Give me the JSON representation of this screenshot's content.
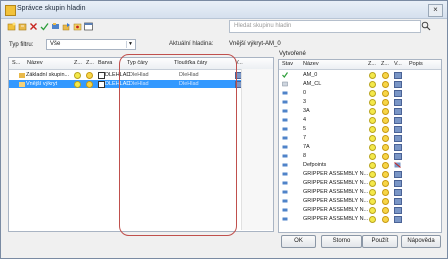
{
  "window": {
    "title": "Správce skupin hladin",
    "close_glyph": "×"
  },
  "search": {
    "placeholder": "Hledat skupinu hladin"
  },
  "filter": {
    "label": "Typ filtru:",
    "value": "Vše"
  },
  "active_layer": {
    "label": "Aktuální hladina:",
    "value": "Vnější výkryt-AM_0"
  },
  "left_panel": {
    "headers": [
      "S...",
      "Název",
      "Z...",
      "Z...",
      "Barva",
      "Typ čáry",
      "Tloušťka čáry",
      "V..."
    ],
    "rows": [
      {
        "name": "Základní skupin...",
        "color": "DLEHLAD",
        "linetype": "DleHlad",
        "lineweight": "DleHlad",
        "selected": false
      },
      {
        "name": "Vnější výkryt",
        "color": "DLEHLAD",
        "linetype": "DleHlad",
        "lineweight": "DleHlad",
        "selected": true
      }
    ]
  },
  "right_panel": {
    "title": "Vytvořené",
    "headers": [
      "Stav",
      "Název",
      "Z...",
      "Z...",
      "V...",
      "Popis"
    ],
    "rows": [
      {
        "name": "AM_0",
        "status": "current"
      },
      {
        "name": "AM_CL",
        "status": "layer"
      },
      {
        "name": "0",
        "status": "layer"
      },
      {
        "name": "3",
        "status": "layer"
      },
      {
        "name": "3A",
        "status": "layer"
      },
      {
        "name": "4",
        "status": "layer"
      },
      {
        "name": "5",
        "status": "layer"
      },
      {
        "name": "7",
        "status": "layer"
      },
      {
        "name": "7A",
        "status": "layer"
      },
      {
        "name": "8",
        "status": "layer"
      },
      {
        "name": "Defpoints",
        "status": "layer"
      },
      {
        "name": "GRIPPER ASSEMBLY N...",
        "status": "layer"
      },
      {
        "name": "GRIPPER ASSEMBLY N...",
        "status": "layer"
      },
      {
        "name": "GRIPPER ASSEMBLY N...",
        "status": "layer"
      },
      {
        "name": "GRIPPER ASSEMBLY N...",
        "status": "layer"
      },
      {
        "name": "GRIPPER ASSEMBLY N...",
        "status": "layer"
      },
      {
        "name": "GRIPPER ASSEMBLY N...",
        "status": "layer"
      }
    ]
  },
  "buttons": {
    "ok": "OK",
    "cancel": "Storno",
    "apply": "Použít",
    "help": "Nápověda"
  },
  "colors": {
    "selection": "#3399ff",
    "annotation": "#c0504d",
    "current_check": "#2e9e3a"
  }
}
